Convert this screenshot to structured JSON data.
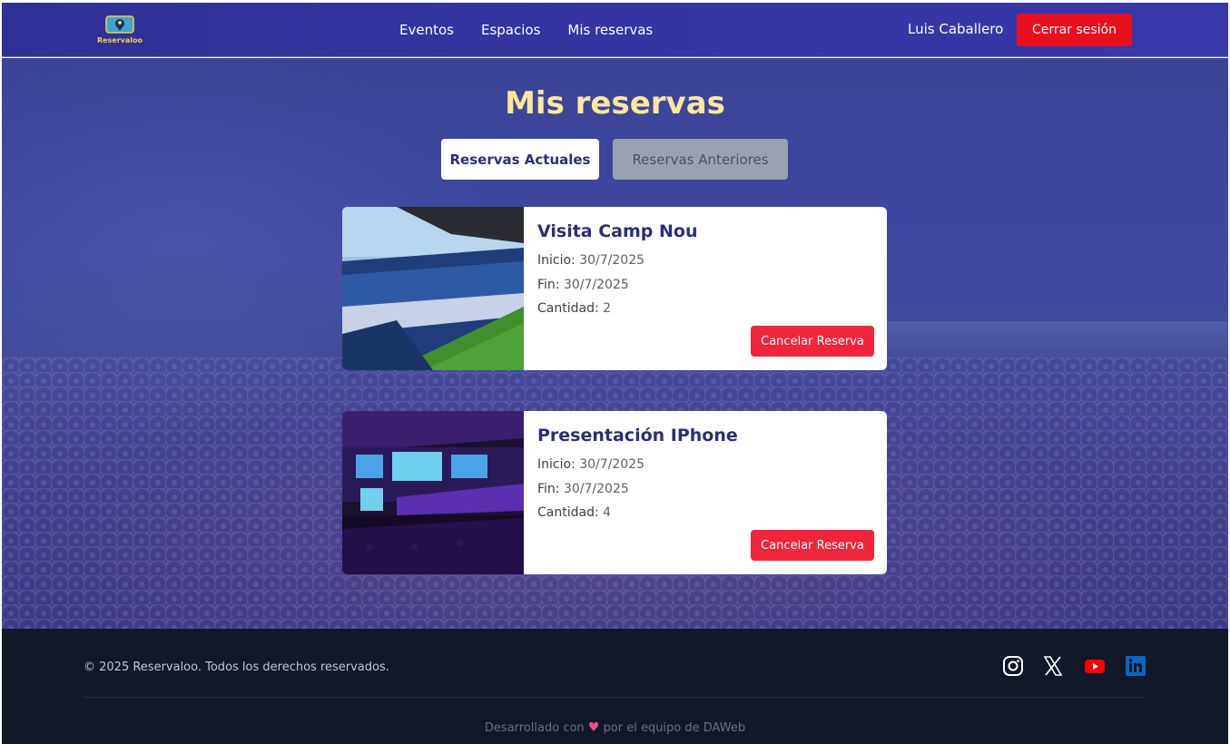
{
  "brand": {
    "logo_text": "Reservaloo"
  },
  "nav": {
    "links": [
      {
        "label": "Eventos"
      },
      {
        "label": "Espacios"
      },
      {
        "label": "Mis reservas"
      }
    ],
    "user_name": "Luis Caballero",
    "logout_label": "Cerrar sesión"
  },
  "page": {
    "title": "Mis reservas",
    "tabs": [
      {
        "label": "Reservas Actuales",
        "active": true
      },
      {
        "label": "Reservas Anteriores",
        "active": false
      }
    ]
  },
  "reservations": [
    {
      "title": "Visita Camp Nou",
      "start_label": "Inicio:",
      "start_value": "30/7/2025",
      "end_label": "Fin:",
      "end_value": "30/7/2025",
      "qty_label": "Cantidad:",
      "qty_value": "2",
      "cancel_label": "Cancelar Reserva"
    },
    {
      "title": "Presentación IPhone",
      "start_label": "Inicio:",
      "start_value": "30/7/2025",
      "end_label": "Fin:",
      "end_value": "30/7/2025",
      "qty_label": "Cantidad:",
      "qty_value": "4",
      "cancel_label": "Cancelar Reserva"
    }
  ],
  "footer": {
    "copyright": "© 2025 Reservaloo. Todos los derechos reservados.",
    "dev_prefix": "Desarrollado con",
    "dev_suffix": "por el equipo de DAWeb",
    "social_icons": [
      "instagram-icon",
      "x-icon",
      "youtube-icon",
      "linkedin-icon"
    ]
  },
  "colors": {
    "nav_bg": "#3435a0",
    "title": "#fde79a",
    "danger": "#e8101d",
    "card_title": "#2b2f78",
    "footer_bg": "#111827"
  }
}
